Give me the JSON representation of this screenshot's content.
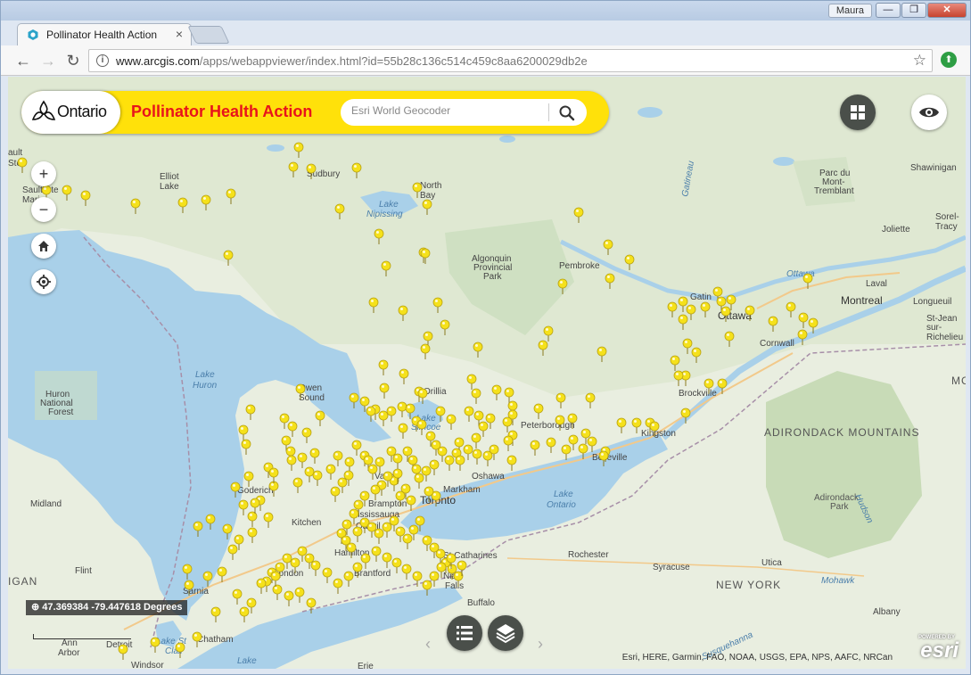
{
  "window": {
    "user_tag": "Maura",
    "minimize": "—",
    "restore": "❐",
    "close": "✕"
  },
  "tab": {
    "title": "Pollinator Health Action",
    "close": "×"
  },
  "toolbar": {
    "back": "←",
    "forward": "→",
    "reload": "↻",
    "url_host": "www.arcgis.com",
    "url_path": "/apps/webappviewer/index.html?id=55b28c136c514c459c8aa6200029db2e"
  },
  "app": {
    "logo": "Ontario",
    "title": "Pollinator Health Action",
    "search_placeholder": "Esri World Geocoder"
  },
  "map": {
    "coords": "47.369384 -79.447618 Degrees",
    "attribution": "Esri, HERE, Garmin, FAO, NOAA, USGS, EPA, NPS, AAFC, NRCan",
    "powered_by": "POWERED BY",
    "esri": "esri",
    "colors": {
      "water": "#a9d0e9",
      "land": "#e8eddf",
      "park": "#cfe0c2",
      "pin": "#f5e11b",
      "border": "#a78fa8"
    },
    "labels": {
      "sault": "ault",
      "ste": "Ste",
      "sault_ste_marie": "Sault Ste",
      "marie": "Marie",
      "elliot_lake": "Elliot",
      "elliot_lake2": "Lake",
      "sudbury": "Sudbury",
      "north_bay": "North",
      "north_bay2": "Bay",
      "lake_nipissing": "Lake",
      "lake_nipissing2": "Nipissing",
      "algonquin": "Algonquin",
      "algonquin2": "Provincial",
      "algonquin3": "Park",
      "pembroke": "Pembroke",
      "parc_du": "Parc du",
      "mont": "Mont-",
      "tremblant": "Tremblant",
      "shawinigan": "Shawinigan",
      "joliette": "Joliette",
      "sorel": "Sorel-",
      "tracy": "Tracy",
      "gatineau_river": "Gatineau",
      "ottawa_river": "Ottawa",
      "laval": "Laval",
      "montreal": "Montreal",
      "longueuil": "Longueuil",
      "st_jean": "St-Jean",
      "sur": "sur-",
      "richelieu": "Richelieu",
      "gatineau": "Gatin",
      "ottawa": "Ottawa",
      "cornwall": "Cornwall",
      "brockville": "Brockville",
      "lake_huron": "Lake",
      "lake_huron2": "Huron",
      "huron_nf": "Huron",
      "huron_nf2": "National",
      "huron_nf3": "Forest",
      "owen_sound": "Owen",
      "owen_sound2": "Sound",
      "orillia": "Orillia",
      "lake_simcoe": "Lake",
      "lake_simcoe2": "Simcoe",
      "peterborough": "Peterborough",
      "kingston": "Kingston",
      "belleville": "Belleville",
      "adirondack_mtns": "ADIRONDACK MOUNTAINS",
      "adirondack_park": "Adirondack",
      "adirondack_park2": "Park",
      "goderich": "Goderich",
      "vaughan": "Vaugh",
      "markham": "Markham",
      "oshawa": "Oshawa",
      "lake_ontario": "Lake",
      "lake_ontario2": "Ontario",
      "toronto": "Toronto",
      "brampton": "Brampton",
      "mississauga": "Mississauga",
      "kitchener": "Kitchen",
      "oakville": "Oakvil",
      "hamilton": "Hamilton",
      "st_catharines": "St Catharines",
      "rochester": "Rochester",
      "midland": "Midland",
      "flint": "Flint",
      "london": "London",
      "brantford": "Brantford",
      "niagara": "Niag",
      "niagara2": "Falls",
      "syracuse": "Syracuse",
      "utica": "Utica",
      "new_york": "NEW YORK",
      "mohawk": "Mohawk",
      "albany": "Albany",
      "sarnia": "Sarnia",
      "buffalo": "Buffalo",
      "michigan": "IGAN",
      "chatham": "Chatham",
      "detroit": "Detroit",
      "ann_arbor": "Ann",
      "ann_arbor2": "Arbor",
      "windsor": "Windsor",
      "lake_st_clair": "Lake St",
      "lake_st_clair2": "Clair",
      "erie": "Erie",
      "lake_erie": "Lake",
      "hudson": "Hudson",
      "susquehanna": "Susquehanna",
      "mc": "MC",
      "plus": "+",
      "minus": "−"
    }
  }
}
